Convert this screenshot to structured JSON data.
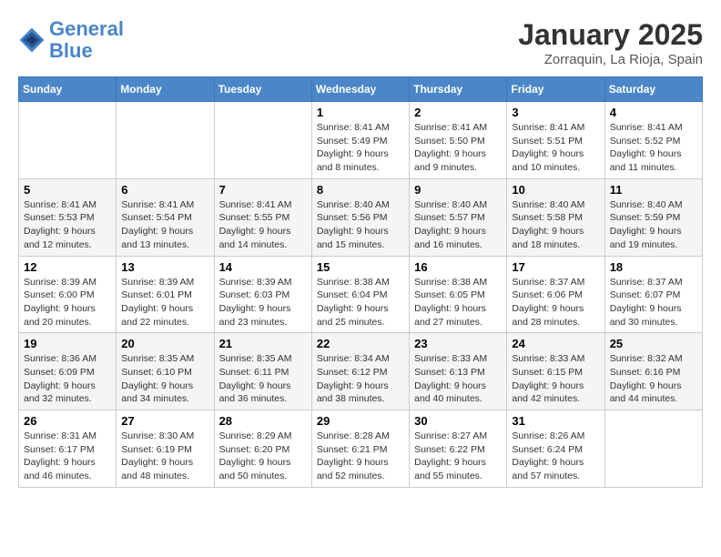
{
  "header": {
    "logo_line1": "General",
    "logo_line2": "Blue",
    "month_title": "January 2025",
    "subtitle": "Zorraquin, La Rioja, Spain"
  },
  "weekdays": [
    "Sunday",
    "Monday",
    "Tuesday",
    "Wednesday",
    "Thursday",
    "Friday",
    "Saturday"
  ],
  "weeks": [
    [
      {
        "day": "",
        "info": ""
      },
      {
        "day": "",
        "info": ""
      },
      {
        "day": "",
        "info": ""
      },
      {
        "day": "1",
        "info": "Sunrise: 8:41 AM\nSunset: 5:49 PM\nDaylight: 9 hours and 8 minutes."
      },
      {
        "day": "2",
        "info": "Sunrise: 8:41 AM\nSunset: 5:50 PM\nDaylight: 9 hours and 9 minutes."
      },
      {
        "day": "3",
        "info": "Sunrise: 8:41 AM\nSunset: 5:51 PM\nDaylight: 9 hours and 10 minutes."
      },
      {
        "day": "4",
        "info": "Sunrise: 8:41 AM\nSunset: 5:52 PM\nDaylight: 9 hours and 11 minutes."
      }
    ],
    [
      {
        "day": "5",
        "info": "Sunrise: 8:41 AM\nSunset: 5:53 PM\nDaylight: 9 hours and 12 minutes."
      },
      {
        "day": "6",
        "info": "Sunrise: 8:41 AM\nSunset: 5:54 PM\nDaylight: 9 hours and 13 minutes."
      },
      {
        "day": "7",
        "info": "Sunrise: 8:41 AM\nSunset: 5:55 PM\nDaylight: 9 hours and 14 minutes."
      },
      {
        "day": "8",
        "info": "Sunrise: 8:40 AM\nSunset: 5:56 PM\nDaylight: 9 hours and 15 minutes."
      },
      {
        "day": "9",
        "info": "Sunrise: 8:40 AM\nSunset: 5:57 PM\nDaylight: 9 hours and 16 minutes."
      },
      {
        "day": "10",
        "info": "Sunrise: 8:40 AM\nSunset: 5:58 PM\nDaylight: 9 hours and 18 minutes."
      },
      {
        "day": "11",
        "info": "Sunrise: 8:40 AM\nSunset: 5:59 PM\nDaylight: 9 hours and 19 minutes."
      }
    ],
    [
      {
        "day": "12",
        "info": "Sunrise: 8:39 AM\nSunset: 6:00 PM\nDaylight: 9 hours and 20 minutes."
      },
      {
        "day": "13",
        "info": "Sunrise: 8:39 AM\nSunset: 6:01 PM\nDaylight: 9 hours and 22 minutes."
      },
      {
        "day": "14",
        "info": "Sunrise: 8:39 AM\nSunset: 6:03 PM\nDaylight: 9 hours and 23 minutes."
      },
      {
        "day": "15",
        "info": "Sunrise: 8:38 AM\nSunset: 6:04 PM\nDaylight: 9 hours and 25 minutes."
      },
      {
        "day": "16",
        "info": "Sunrise: 8:38 AM\nSunset: 6:05 PM\nDaylight: 9 hours and 27 minutes."
      },
      {
        "day": "17",
        "info": "Sunrise: 8:37 AM\nSunset: 6:06 PM\nDaylight: 9 hours and 28 minutes."
      },
      {
        "day": "18",
        "info": "Sunrise: 8:37 AM\nSunset: 6:07 PM\nDaylight: 9 hours and 30 minutes."
      }
    ],
    [
      {
        "day": "19",
        "info": "Sunrise: 8:36 AM\nSunset: 6:09 PM\nDaylight: 9 hours and 32 minutes."
      },
      {
        "day": "20",
        "info": "Sunrise: 8:35 AM\nSunset: 6:10 PM\nDaylight: 9 hours and 34 minutes."
      },
      {
        "day": "21",
        "info": "Sunrise: 8:35 AM\nSunset: 6:11 PM\nDaylight: 9 hours and 36 minutes."
      },
      {
        "day": "22",
        "info": "Sunrise: 8:34 AM\nSunset: 6:12 PM\nDaylight: 9 hours and 38 minutes."
      },
      {
        "day": "23",
        "info": "Sunrise: 8:33 AM\nSunset: 6:13 PM\nDaylight: 9 hours and 40 minutes."
      },
      {
        "day": "24",
        "info": "Sunrise: 8:33 AM\nSunset: 6:15 PM\nDaylight: 9 hours and 42 minutes."
      },
      {
        "day": "25",
        "info": "Sunrise: 8:32 AM\nSunset: 6:16 PM\nDaylight: 9 hours and 44 minutes."
      }
    ],
    [
      {
        "day": "26",
        "info": "Sunrise: 8:31 AM\nSunset: 6:17 PM\nDaylight: 9 hours and 46 minutes."
      },
      {
        "day": "27",
        "info": "Sunrise: 8:30 AM\nSunset: 6:19 PM\nDaylight: 9 hours and 48 minutes."
      },
      {
        "day": "28",
        "info": "Sunrise: 8:29 AM\nSunset: 6:20 PM\nDaylight: 9 hours and 50 minutes."
      },
      {
        "day": "29",
        "info": "Sunrise: 8:28 AM\nSunset: 6:21 PM\nDaylight: 9 hours and 52 minutes."
      },
      {
        "day": "30",
        "info": "Sunrise: 8:27 AM\nSunset: 6:22 PM\nDaylight: 9 hours and 55 minutes."
      },
      {
        "day": "31",
        "info": "Sunrise: 8:26 AM\nSunset: 6:24 PM\nDaylight: 9 hours and 57 minutes."
      },
      {
        "day": "",
        "info": ""
      }
    ]
  ]
}
